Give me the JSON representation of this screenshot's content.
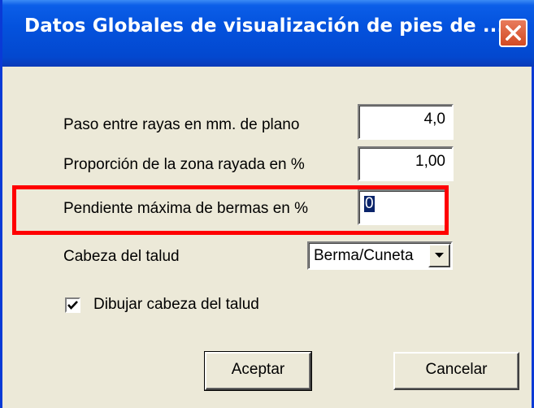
{
  "window": {
    "title": "Datos Globales de visualización de pies de ..."
  },
  "form": {
    "paso": {
      "label": "Paso entre rayas en mm. de plano",
      "value": "4,0"
    },
    "proporcion": {
      "label": "Proporción de la zona rayada  en %",
      "value": "1,00"
    },
    "pendiente": {
      "label": "Pendiente máxima de bermas en %",
      "value": "0"
    },
    "cabeza": {
      "label": "Cabeza del talud",
      "selected": "Berma/Cuneta"
    },
    "dibujar": {
      "label": "Dibujar cabeza del talud",
      "checked": true
    }
  },
  "buttons": {
    "accept": "Aceptar",
    "cancel": "Cancelar"
  },
  "colors": {
    "titlebar": "#0452dd",
    "highlight": "#ff0000",
    "dialog_bg": "#ece9d8"
  }
}
